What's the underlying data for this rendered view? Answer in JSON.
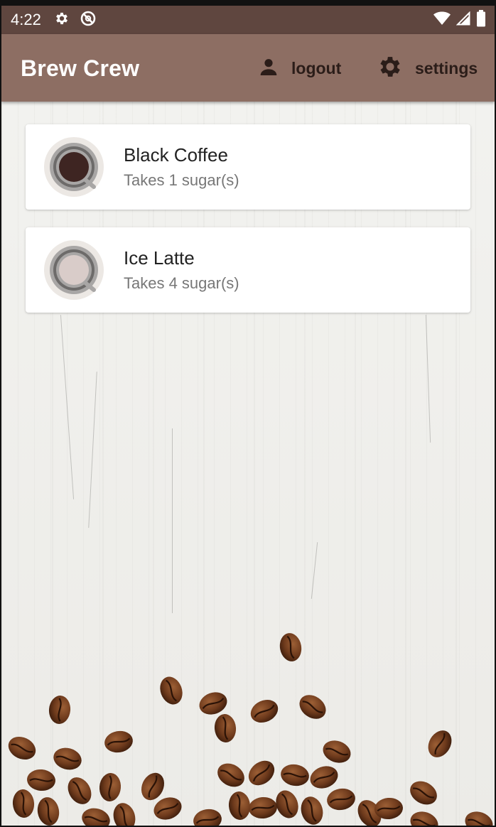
{
  "status_bar": {
    "time": "4:22",
    "icons_left": [
      "gear-icon",
      "no-sync-icon"
    ],
    "icons_right": [
      "wifi-icon",
      "signal-icon",
      "battery-icon"
    ]
  },
  "app_bar": {
    "title": "Brew Crew",
    "logout_label": "logout",
    "settings_label": "settings",
    "color": "#8d6e63",
    "status_color": "#5f463f"
  },
  "brews": [
    {
      "name": "Black Coffee",
      "subtitle": "Takes 1 sugar(s)",
      "cup_color": "#3e2522"
    },
    {
      "name": "Ice Latte",
      "subtitle": "Takes 4 sugar(s)",
      "cup_color": "#d9ccc9"
    }
  ]
}
